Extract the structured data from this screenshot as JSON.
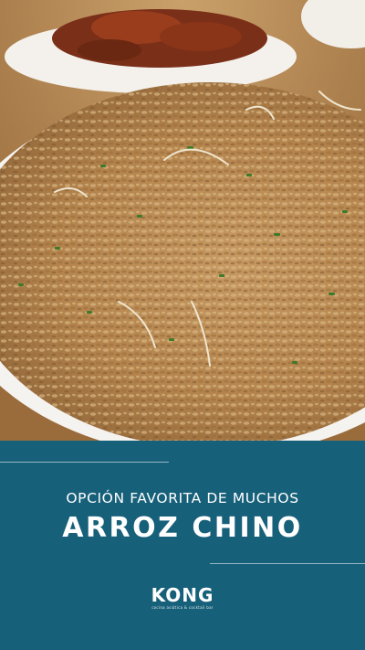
{
  "promo": {
    "subtitle": "OPCIÓN FAVORITA DE MUCHOS",
    "title": "ARROZ CHINO"
  },
  "brand": {
    "name": "KONG",
    "tagline": "cocina asiática & cocktail bar"
  },
  "colors": {
    "panel_background": "#17607a",
    "text": "#ffffff",
    "rice": "#b98a4f"
  }
}
